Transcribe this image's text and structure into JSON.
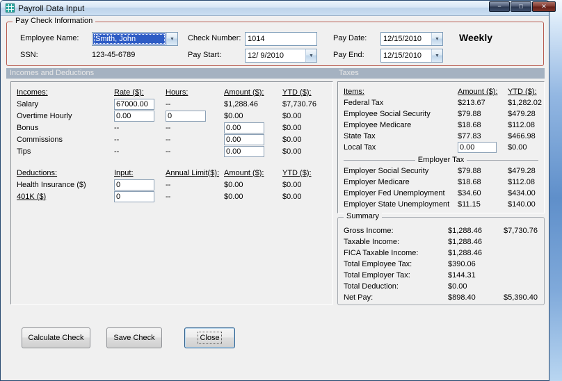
{
  "window": {
    "title": "Payroll Data Input",
    "controls": {
      "minimize": "−",
      "maximize": "□",
      "close": "✕"
    }
  },
  "icons": {
    "dropdown_arrow": "▼"
  },
  "paycheck": {
    "group_label": "Pay Check Information",
    "employee_name_label": "Employee Name:",
    "employee_name_value": "Smith, John",
    "ssn_label": "SSN:",
    "ssn_value": "123-45-6789",
    "check_number_label": "Check Number:",
    "check_number_value": "1014",
    "pay_start_label": "Pay Start:",
    "pay_start_value": "12/ 9/2010",
    "pay_date_label": "Pay Date:",
    "pay_date_value": "12/15/2010",
    "pay_end_label": "Pay End:",
    "pay_end_value": "12/15/2010",
    "frequency": "Weekly"
  },
  "sections": {
    "left": "Incomes and Deductions",
    "right": "Taxes"
  },
  "incomes": {
    "headers": {
      "name": "Incomes:",
      "rate": "Rate ($):",
      "hours": "Hours:",
      "amount": "Amount ($):",
      "ytd": "YTD ($):"
    },
    "rows": [
      {
        "name": "Salary",
        "rate": "67000.00",
        "hours": "--",
        "amount": "$1,288.46",
        "ytd": "$7,730.76"
      },
      {
        "name": "Overtime Hourly",
        "rate": "0.00",
        "hours": "0",
        "amount": "$0.00",
        "ytd": "$0.00"
      },
      {
        "name": "Bonus",
        "rate": "--",
        "hours": "--",
        "amount": "0.00",
        "ytd": "$0.00"
      },
      {
        "name": "Commissions",
        "rate": "--",
        "hours": "--",
        "amount": "0.00",
        "ytd": "$0.00"
      },
      {
        "name": "Tips",
        "rate": "--",
        "hours": "--",
        "amount": "0.00",
        "ytd": "$0.00"
      }
    ]
  },
  "deductions": {
    "headers": {
      "name": "Deductions:",
      "input": "Input:",
      "limit": "Annual Limit($):",
      "amount": "Amount ($):",
      "ytd": "YTD ($):"
    },
    "rows": [
      {
        "name": "Health Insurance ($)",
        "input": "0",
        "limit": "--",
        "amount": "$0.00",
        "ytd": "$0.00"
      },
      {
        "name": "401K ($)",
        "input": "0",
        "limit": "--",
        "amount": "$0.00",
        "ytd": "$0.00"
      }
    ]
  },
  "taxes": {
    "headers": {
      "item": "Items:",
      "amount": "Amount ($):",
      "ytd": "YTD ($):"
    },
    "employee_rows": [
      {
        "item": "Federal Tax",
        "amount": "$213.67",
        "ytd": "$1,282.02"
      },
      {
        "item": "Employee Social Security",
        "amount": "$79.88",
        "ytd": "$479.28"
      },
      {
        "item": "Employee Medicare",
        "amount": "$18.68",
        "ytd": "$112.08"
      },
      {
        "item": "State Tax",
        "amount": "$77.83",
        "ytd": "$466.98"
      },
      {
        "item": "Local Tax",
        "amount": "0.00",
        "ytd": "$0.00"
      }
    ],
    "employer_group_label": "Employer Tax",
    "employer_rows": [
      {
        "item": "Employer Social Security",
        "amount": "$79.88",
        "ytd": "$479.28"
      },
      {
        "item": "Employer Medicare",
        "amount": "$18.68",
        "ytd": "$112.08"
      },
      {
        "item": "Employer Fed Unemployment",
        "amount": "$34.60",
        "ytd": "$434.00"
      },
      {
        "item": "Employer State Unemployment",
        "amount": "$11.15",
        "ytd": "$140.00"
      }
    ]
  },
  "summary": {
    "group_label": "Summary",
    "rows": [
      {
        "label": "Gross Income:",
        "amount": "$1,288.46",
        "ytd": "$7,730.76"
      },
      {
        "label": "Taxable Income:",
        "amount": "$1,288.46",
        "ytd": ""
      },
      {
        "label": "FICA Taxable Income:",
        "amount": "$1,288.46",
        "ytd": ""
      },
      {
        "label": "Total Employee Tax:",
        "amount": "$390.06",
        "ytd": ""
      },
      {
        "label": "Total Employer Tax:",
        "amount": "$144.31",
        "ytd": ""
      },
      {
        "label": "Total Deduction:",
        "amount": "$0.00",
        "ytd": ""
      },
      {
        "label": "Net Pay:",
        "amount": "$898.40",
        "ytd": "$5,390.40"
      }
    ]
  },
  "buttons": {
    "calculate": "Calculate Check",
    "save": "Save Check",
    "close": "Close"
  }
}
